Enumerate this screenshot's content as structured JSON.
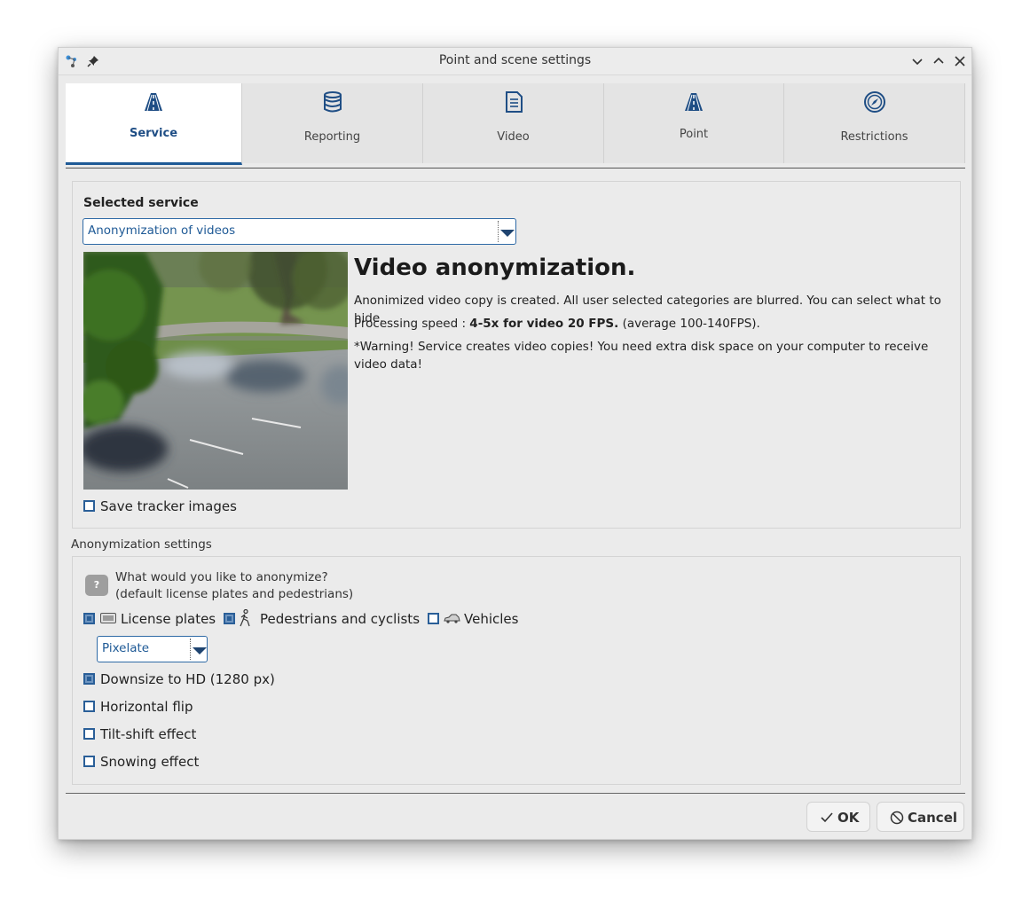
{
  "window": {
    "title": "Point and scene settings"
  },
  "tabs": [
    {
      "label": "Service",
      "icon": "road-icon",
      "active": true
    },
    {
      "label": "Reporting",
      "icon": "database-icon",
      "active": false
    },
    {
      "label": "Video",
      "icon": "document-icon",
      "active": false
    },
    {
      "label": "Point",
      "icon": "road-icon",
      "active": false
    },
    {
      "label": "Restrictions",
      "icon": "compass-icon",
      "active": false
    }
  ],
  "service": {
    "selected_label": "Selected service",
    "selected_value": "Anonymization of videos",
    "headline": "Video anonymization.",
    "description": "Anonimized video copy is created. All user selected categories are blurred. You can select what to hide.",
    "speed_prefix": "Processing speed : ",
    "speed_bold": "4-5x for video 20 FPS.",
    "speed_suffix": " (average 100-140FPS).",
    "warning": "*Warning! Service creates video copies! You need extra disk space on your computer to receive video data!",
    "save_tracker_label": "Save tracker images",
    "save_tracker_checked": false
  },
  "anonymization": {
    "section_title": "Anonymization settings",
    "help_label": "?",
    "question_line1": "What would you like to anonymize?",
    "question_line2": "(default license plates and pedestrians)",
    "license_plates_label": "License plates",
    "license_plates_checked": true,
    "pedestrians_label": "Pedestrians and cyclists",
    "pedestrians_checked": true,
    "vehicles_label": "Vehicles",
    "vehicles_checked": false,
    "method_value": "Pixelate",
    "downsize_label": "Downsize to HD (1280 px)",
    "downsize_checked": true,
    "hflip_label": "Horizontal flip",
    "hflip_checked": false,
    "tiltshift_label": "Tilt-shift effect",
    "tiltshift_checked": false,
    "snowing_label": "Snowing effect",
    "snowing_checked": false
  },
  "buttons": {
    "ok_label": "OK",
    "cancel_label": "Cancel"
  },
  "colors": {
    "accent": "#1f5a96",
    "window_bg": "#ebebeb"
  }
}
